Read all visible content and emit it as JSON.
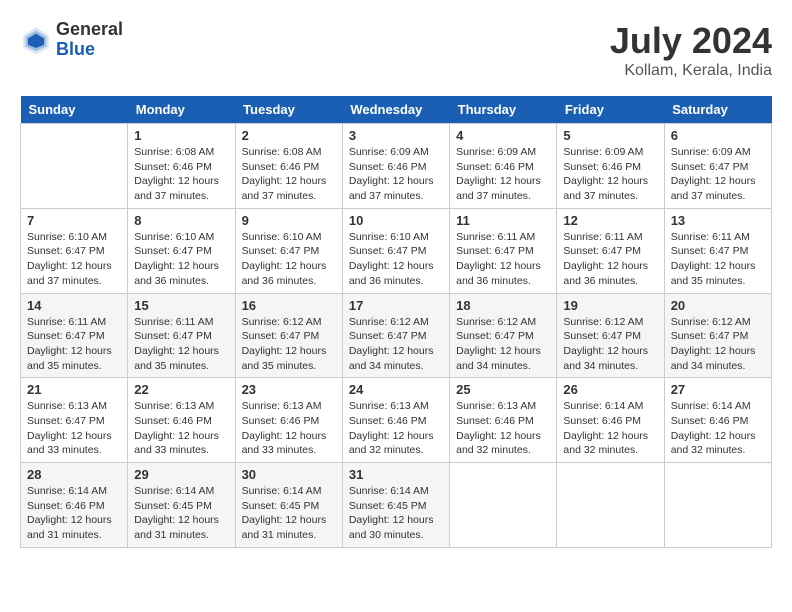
{
  "header": {
    "logo_general": "General",
    "logo_blue": "Blue",
    "main_title": "July 2024",
    "subtitle": "Kollam, Kerala, India"
  },
  "days": [
    "Sunday",
    "Monday",
    "Tuesday",
    "Wednesday",
    "Thursday",
    "Friday",
    "Saturday"
  ],
  "weeks": [
    [
      {
        "date": "",
        "sunrise": "",
        "sunset": "",
        "daylight": ""
      },
      {
        "date": "1",
        "sunrise": "Sunrise: 6:08 AM",
        "sunset": "Sunset: 6:46 PM",
        "daylight": "Daylight: 12 hours and 37 minutes."
      },
      {
        "date": "2",
        "sunrise": "Sunrise: 6:08 AM",
        "sunset": "Sunset: 6:46 PM",
        "daylight": "Daylight: 12 hours and 37 minutes."
      },
      {
        "date": "3",
        "sunrise": "Sunrise: 6:09 AM",
        "sunset": "Sunset: 6:46 PM",
        "daylight": "Daylight: 12 hours and 37 minutes."
      },
      {
        "date": "4",
        "sunrise": "Sunrise: 6:09 AM",
        "sunset": "Sunset: 6:46 PM",
        "daylight": "Daylight: 12 hours and 37 minutes."
      },
      {
        "date": "5",
        "sunrise": "Sunrise: 6:09 AM",
        "sunset": "Sunset: 6:46 PM",
        "daylight": "Daylight: 12 hours and 37 minutes."
      },
      {
        "date": "6",
        "sunrise": "Sunrise: 6:09 AM",
        "sunset": "Sunset: 6:47 PM",
        "daylight": "Daylight: 12 hours and 37 minutes."
      }
    ],
    [
      {
        "date": "7",
        "sunrise": "Sunrise: 6:10 AM",
        "sunset": "Sunset: 6:47 PM",
        "daylight": "Daylight: 12 hours and 37 minutes."
      },
      {
        "date": "8",
        "sunrise": "Sunrise: 6:10 AM",
        "sunset": "Sunset: 6:47 PM",
        "daylight": "Daylight: 12 hours and 36 minutes."
      },
      {
        "date": "9",
        "sunrise": "Sunrise: 6:10 AM",
        "sunset": "Sunset: 6:47 PM",
        "daylight": "Daylight: 12 hours and 36 minutes."
      },
      {
        "date": "10",
        "sunrise": "Sunrise: 6:10 AM",
        "sunset": "Sunset: 6:47 PM",
        "daylight": "Daylight: 12 hours and 36 minutes."
      },
      {
        "date": "11",
        "sunrise": "Sunrise: 6:11 AM",
        "sunset": "Sunset: 6:47 PM",
        "daylight": "Daylight: 12 hours and 36 minutes."
      },
      {
        "date": "12",
        "sunrise": "Sunrise: 6:11 AM",
        "sunset": "Sunset: 6:47 PM",
        "daylight": "Daylight: 12 hours and 36 minutes."
      },
      {
        "date": "13",
        "sunrise": "Sunrise: 6:11 AM",
        "sunset": "Sunset: 6:47 PM",
        "daylight": "Daylight: 12 hours and 35 minutes."
      }
    ],
    [
      {
        "date": "14",
        "sunrise": "Sunrise: 6:11 AM",
        "sunset": "Sunset: 6:47 PM",
        "daylight": "Daylight: 12 hours and 35 minutes."
      },
      {
        "date": "15",
        "sunrise": "Sunrise: 6:11 AM",
        "sunset": "Sunset: 6:47 PM",
        "daylight": "Daylight: 12 hours and 35 minutes."
      },
      {
        "date": "16",
        "sunrise": "Sunrise: 6:12 AM",
        "sunset": "Sunset: 6:47 PM",
        "daylight": "Daylight: 12 hours and 35 minutes."
      },
      {
        "date": "17",
        "sunrise": "Sunrise: 6:12 AM",
        "sunset": "Sunset: 6:47 PM",
        "daylight": "Daylight: 12 hours and 34 minutes."
      },
      {
        "date": "18",
        "sunrise": "Sunrise: 6:12 AM",
        "sunset": "Sunset: 6:47 PM",
        "daylight": "Daylight: 12 hours and 34 minutes."
      },
      {
        "date": "19",
        "sunrise": "Sunrise: 6:12 AM",
        "sunset": "Sunset: 6:47 PM",
        "daylight": "Daylight: 12 hours and 34 minutes."
      },
      {
        "date": "20",
        "sunrise": "Sunrise: 6:12 AM",
        "sunset": "Sunset: 6:47 PM",
        "daylight": "Daylight: 12 hours and 34 minutes."
      }
    ],
    [
      {
        "date": "21",
        "sunrise": "Sunrise: 6:13 AM",
        "sunset": "Sunset: 6:47 PM",
        "daylight": "Daylight: 12 hours and 33 minutes."
      },
      {
        "date": "22",
        "sunrise": "Sunrise: 6:13 AM",
        "sunset": "Sunset: 6:46 PM",
        "daylight": "Daylight: 12 hours and 33 minutes."
      },
      {
        "date": "23",
        "sunrise": "Sunrise: 6:13 AM",
        "sunset": "Sunset: 6:46 PM",
        "daylight": "Daylight: 12 hours and 33 minutes."
      },
      {
        "date": "24",
        "sunrise": "Sunrise: 6:13 AM",
        "sunset": "Sunset: 6:46 PM",
        "daylight": "Daylight: 12 hours and 32 minutes."
      },
      {
        "date": "25",
        "sunrise": "Sunrise: 6:13 AM",
        "sunset": "Sunset: 6:46 PM",
        "daylight": "Daylight: 12 hours and 32 minutes."
      },
      {
        "date": "26",
        "sunrise": "Sunrise: 6:14 AM",
        "sunset": "Sunset: 6:46 PM",
        "daylight": "Daylight: 12 hours and 32 minutes."
      },
      {
        "date": "27",
        "sunrise": "Sunrise: 6:14 AM",
        "sunset": "Sunset: 6:46 PM",
        "daylight": "Daylight: 12 hours and 32 minutes."
      }
    ],
    [
      {
        "date": "28",
        "sunrise": "Sunrise: 6:14 AM",
        "sunset": "Sunset: 6:46 PM",
        "daylight": "Daylight: 12 hours and 31 minutes."
      },
      {
        "date": "29",
        "sunrise": "Sunrise: 6:14 AM",
        "sunset": "Sunset: 6:45 PM",
        "daylight": "Daylight: 12 hours and 31 minutes."
      },
      {
        "date": "30",
        "sunrise": "Sunrise: 6:14 AM",
        "sunset": "Sunset: 6:45 PM",
        "daylight": "Daylight: 12 hours and 31 minutes."
      },
      {
        "date": "31",
        "sunrise": "Sunrise: 6:14 AM",
        "sunset": "Sunset: 6:45 PM",
        "daylight": "Daylight: 12 hours and 30 minutes."
      },
      {
        "date": "",
        "sunrise": "",
        "sunset": "",
        "daylight": ""
      },
      {
        "date": "",
        "sunrise": "",
        "sunset": "",
        "daylight": ""
      },
      {
        "date": "",
        "sunrise": "",
        "sunset": "",
        "daylight": ""
      }
    ]
  ]
}
